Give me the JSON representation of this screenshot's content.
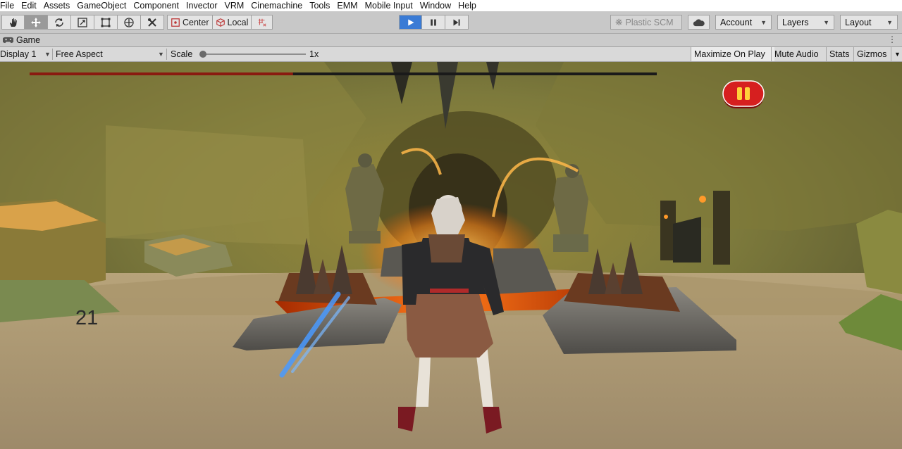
{
  "menu": [
    "File",
    "Edit",
    "Assets",
    "GameObject",
    "Component",
    "Invector",
    "VRM",
    "Cinemachine",
    "Tools",
    "EMM",
    "Mobile Input",
    "Window",
    "Help"
  ],
  "toolbar": {
    "tools": [
      "hand-icon",
      "move-icon",
      "rotate-icon",
      "scale-icon",
      "rect-icon",
      "transform-icon",
      "custom-tool-icon"
    ],
    "pivot_label": "Center",
    "space_label": "Local",
    "plastic_label": "Plastic SCM",
    "account_label": "Account",
    "layers_label": "Layers",
    "layout_label": "Layout"
  },
  "tab": {
    "title": "Game"
  },
  "gamebar": {
    "display": "Display 1",
    "aspect": "Free Aspect",
    "scale_label": "Scale",
    "scale_value": "1x",
    "maximize": "Maximize On Play",
    "mute": "Mute Audio",
    "stats": "Stats",
    "gizmos": "Gizmos"
  },
  "game": {
    "counter": "21",
    "health_bar_fill": 0.42
  },
  "colors": {
    "play_active": "#3a7bd5",
    "pause_button": "#d61f1f"
  }
}
